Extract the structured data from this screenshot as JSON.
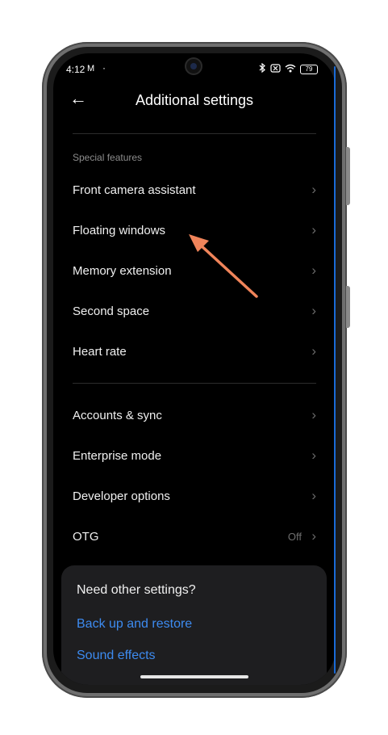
{
  "status_bar": {
    "time": "4:12",
    "mail_icon": "M",
    "dot": "·",
    "battery": "79"
  },
  "header": {
    "back_icon": "←",
    "title": "Additional settings"
  },
  "section_label": "Special features",
  "special_features": [
    {
      "label": "Front camera assistant"
    },
    {
      "label": "Floating windows"
    },
    {
      "label": "Memory extension"
    },
    {
      "label": "Second space"
    },
    {
      "label": "Heart rate"
    }
  ],
  "other_settings": [
    {
      "label": "Accounts & sync",
      "value": ""
    },
    {
      "label": "Enterprise mode",
      "value": ""
    },
    {
      "label": "Developer options",
      "value": ""
    },
    {
      "label": "OTG",
      "value": "Off"
    }
  ],
  "suggestions": {
    "heading": "Need other settings?",
    "links": [
      "Back up and restore",
      "Sound effects"
    ]
  },
  "colors": {
    "background": "#000000",
    "link": "#3d8bf0",
    "annotation_arrow": "#f0845a"
  }
}
